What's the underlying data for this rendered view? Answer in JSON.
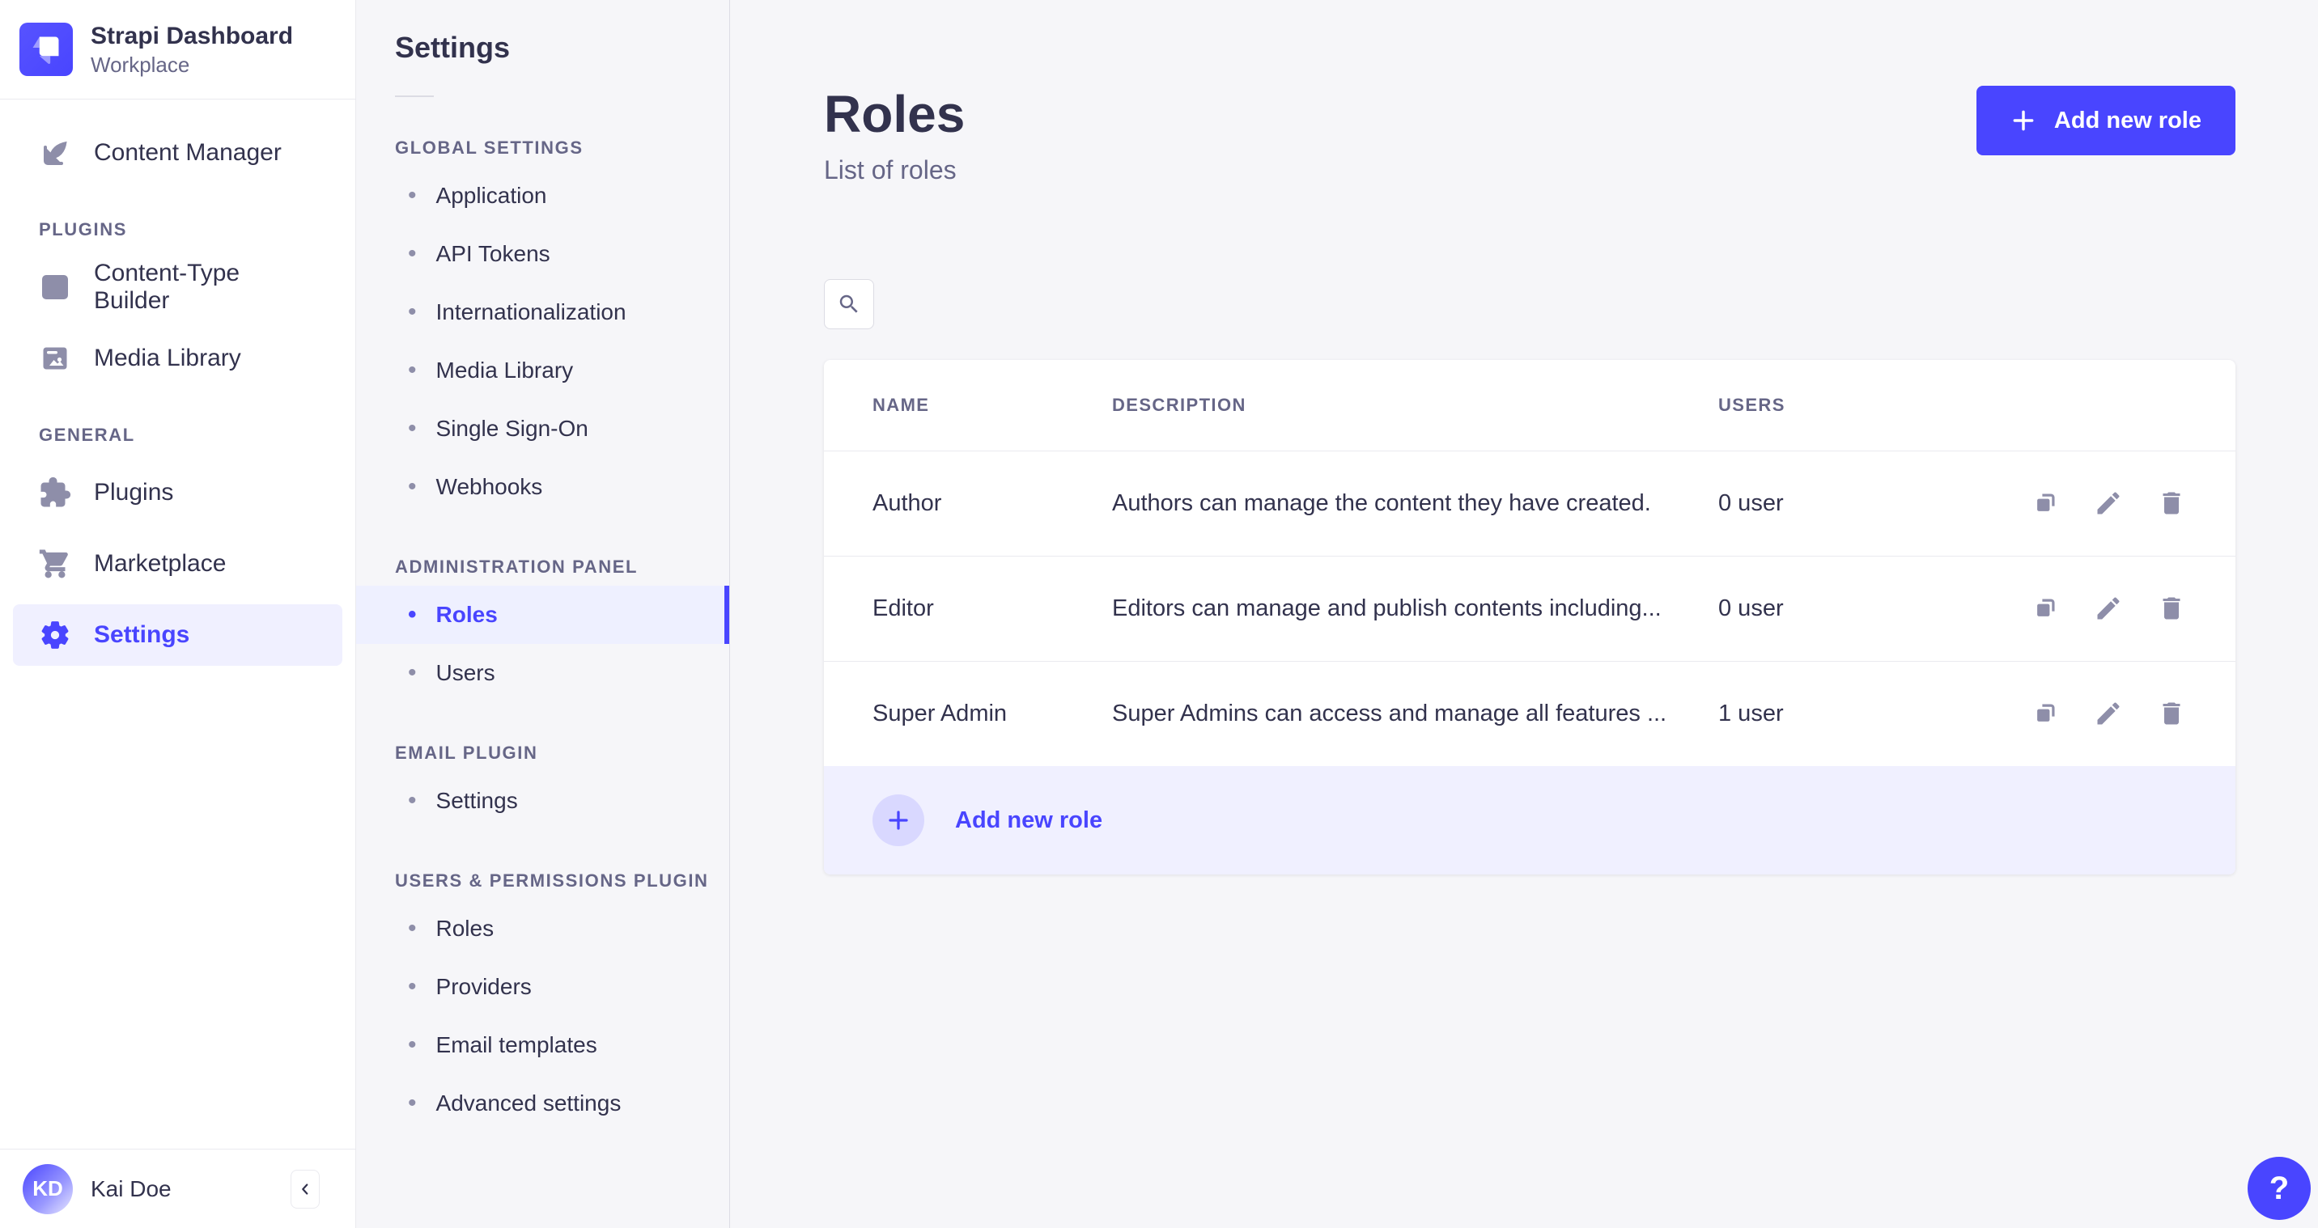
{
  "app": {
    "title": "Strapi Dashboard",
    "workspace": "Workplace"
  },
  "colors": {
    "primary": "#4945ff",
    "primary_light_bg": "#f0f0ff",
    "text_dark": "#32324d",
    "text_muted": "#666687",
    "icon_gray": "#8e8ea9",
    "border": "#dcdce4",
    "page_bg": "#f6f6f9"
  },
  "sidebar": {
    "top_items": [
      {
        "label": "Content Manager",
        "icon": "feather-pen-icon"
      }
    ],
    "sections": [
      {
        "label": "PLUGINS",
        "items": [
          {
            "label": "Content-Type Builder",
            "icon": "layout-icon"
          },
          {
            "label": "Media Library",
            "icon": "picture-icon"
          }
        ]
      },
      {
        "label": "GENERAL",
        "items": [
          {
            "label": "Plugins",
            "icon": "puzzle-icon"
          },
          {
            "label": "Marketplace",
            "icon": "cart-icon"
          },
          {
            "label": "Settings",
            "icon": "gear-icon",
            "active": true
          }
        ]
      }
    ],
    "footer": {
      "avatar_initials": "KD",
      "user_name": "Kai Doe"
    }
  },
  "subnav": {
    "title": "Settings",
    "groups": [
      {
        "label": "GLOBAL SETTINGS",
        "items": [
          "Application",
          "API Tokens",
          "Internationalization",
          "Media Library",
          "Single Sign-On",
          "Webhooks"
        ]
      },
      {
        "label": "ADMINISTRATION PANEL",
        "items": [
          "Roles",
          "Users"
        ],
        "active_item": "Roles"
      },
      {
        "label": "EMAIL PLUGIN",
        "items": [
          "Settings"
        ]
      },
      {
        "label": "USERS & PERMISSIONS PLUGIN",
        "items": [
          "Roles",
          "Providers",
          "Email templates",
          "Advanced settings"
        ]
      }
    ]
  },
  "main": {
    "title": "Roles",
    "subtitle": "List of roles",
    "add_button_label": "Add new role",
    "table": {
      "headers": {
        "name": "NAME",
        "description": "DESCRIPTION",
        "users": "USERS"
      },
      "rows": [
        {
          "name": "Author",
          "description": "Authors can manage the content they have created.",
          "users": "0 user"
        },
        {
          "name": "Editor",
          "description": "Editors can manage and publish contents including...",
          "users": "0 user"
        },
        {
          "name": "Super Admin",
          "description": "Super Admins can access and manage all features ...",
          "users": "1 user"
        }
      ],
      "footer_action_label": "Add new role"
    },
    "help_label": "?"
  }
}
